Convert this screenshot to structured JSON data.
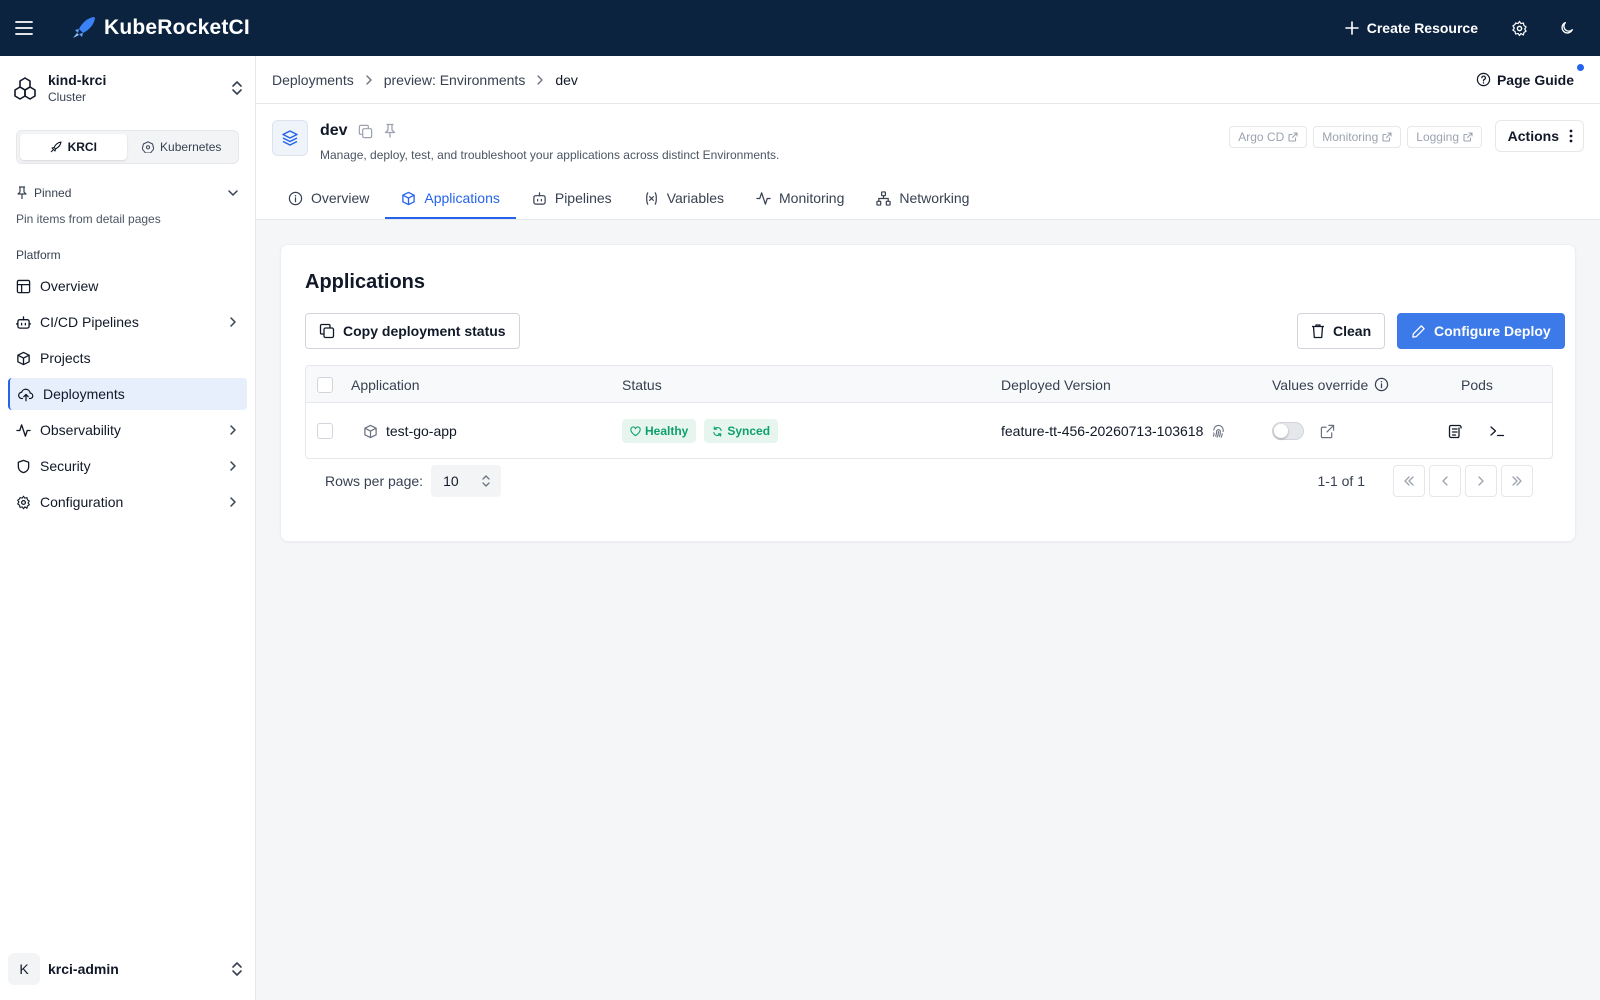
{
  "topbar": {
    "brand": "KubeRocketCI",
    "create_label": "Create Resource"
  },
  "sidebar": {
    "cluster_name": "kind-krci",
    "cluster_type": "Cluster",
    "switch": [
      "KRCI",
      "Kubernetes"
    ],
    "pinned_label": "Pinned",
    "pinned_hint": "Pin items from detail pages",
    "section_label": "Platform",
    "items": [
      {
        "label": "Overview"
      },
      {
        "label": "CI/CD Pipelines"
      },
      {
        "label": "Projects"
      },
      {
        "label": "Deployments"
      },
      {
        "label": "Observability"
      },
      {
        "label": "Security"
      },
      {
        "label": "Configuration"
      }
    ],
    "user_initial": "K",
    "user_name": "krci-admin"
  },
  "breadcrumb": [
    "Deployments",
    "preview: Environments",
    "dev"
  ],
  "page_guide": "Page Guide",
  "header": {
    "name": "dev",
    "description": "Manage, deploy, test, and troubleshoot your applications across distinct Environments.",
    "links": [
      "Argo CD",
      "Monitoring",
      "Logging"
    ],
    "actions_label": "Actions"
  },
  "tabs": [
    "Overview",
    "Applications",
    "Pipelines",
    "Variables",
    "Monitoring",
    "Networking"
  ],
  "accent_color": "#2563eb",
  "applications": {
    "title": "Applications",
    "copy_label": "Copy deployment status",
    "clean_label": "Clean",
    "configure_label": "Configure Deploy",
    "columns": [
      "Application",
      "Status",
      "Deployed Version",
      "Values override",
      "Pods"
    ],
    "rows": [
      {
        "name": "test-go-app",
        "health": "Healthy",
        "sync": "Synced",
        "version": "feature-tt-456-20260713-103618",
        "values_override": false
      }
    ],
    "rows_per_page_label": "Rows per page:",
    "rows_per_page": "10",
    "page_info": "1-1 of 1"
  }
}
